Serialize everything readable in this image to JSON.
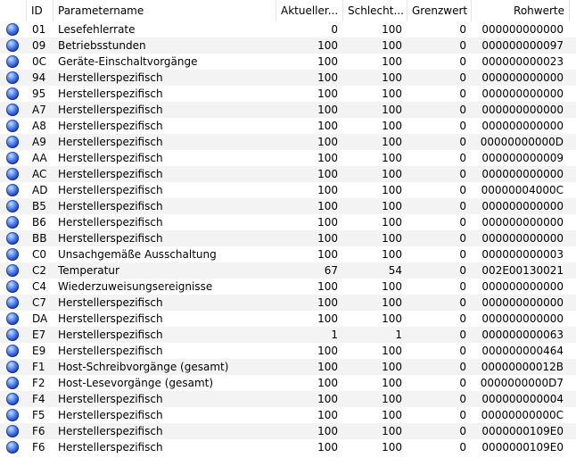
{
  "header": {
    "id": "ID",
    "name": "Parametername",
    "current": "Aktueller...",
    "worst": "Schlecht...",
    "threshold": "Grenzwert",
    "raw": "Rohwerte"
  },
  "icon": "status-dot-blue-icon",
  "rows": [
    {
      "id": "01",
      "name": "Lesefehlerrate",
      "current": "0",
      "worst": "100",
      "threshold": "0",
      "raw": "000000000000"
    },
    {
      "id": "09",
      "name": "Betriebsstunden",
      "current": "100",
      "worst": "100",
      "threshold": "0",
      "raw": "000000000097"
    },
    {
      "id": "0C",
      "name": "Geräte-Einschaltvorgänge",
      "current": "100",
      "worst": "100",
      "threshold": "0",
      "raw": "000000000023"
    },
    {
      "id": "94",
      "name": "Herstellerspezifisch",
      "current": "100",
      "worst": "100",
      "threshold": "0",
      "raw": "000000000000"
    },
    {
      "id": "95",
      "name": "Herstellerspezifisch",
      "current": "100",
      "worst": "100",
      "threshold": "0",
      "raw": "000000000000"
    },
    {
      "id": "A7",
      "name": "Herstellerspezifisch",
      "current": "100",
      "worst": "100",
      "threshold": "0",
      "raw": "000000000000"
    },
    {
      "id": "A8",
      "name": "Herstellerspezifisch",
      "current": "100",
      "worst": "100",
      "threshold": "0",
      "raw": "000000000000"
    },
    {
      "id": "A9",
      "name": "Herstellerspezifisch",
      "current": "100",
      "worst": "100",
      "threshold": "0",
      "raw": "00000000000D"
    },
    {
      "id": "AA",
      "name": "Herstellerspezifisch",
      "current": "100",
      "worst": "100",
      "threshold": "0",
      "raw": "000000000009"
    },
    {
      "id": "AC",
      "name": "Herstellerspezifisch",
      "current": "100",
      "worst": "100",
      "threshold": "0",
      "raw": "000000000000"
    },
    {
      "id": "AD",
      "name": "Herstellerspezifisch",
      "current": "100",
      "worst": "100",
      "threshold": "0",
      "raw": "00000004000C"
    },
    {
      "id": "B5",
      "name": "Herstellerspezifisch",
      "current": "100",
      "worst": "100",
      "threshold": "0",
      "raw": "000000000000"
    },
    {
      "id": "B6",
      "name": "Herstellerspezifisch",
      "current": "100",
      "worst": "100",
      "threshold": "0",
      "raw": "000000000000"
    },
    {
      "id": "BB",
      "name": "Herstellerspezifisch",
      "current": "100",
      "worst": "100",
      "threshold": "0",
      "raw": "000000000000"
    },
    {
      "id": "C0",
      "name": "Unsachgemäße Ausschaltung",
      "current": "100",
      "worst": "100",
      "threshold": "0",
      "raw": "000000000003"
    },
    {
      "id": "C2",
      "name": "Temperatur",
      "current": "67",
      "worst": "54",
      "threshold": "0",
      "raw": "002E00130021"
    },
    {
      "id": "C4",
      "name": "Wiederzuweisungsereignisse",
      "current": "100",
      "worst": "100",
      "threshold": "0",
      "raw": "000000000000"
    },
    {
      "id": "C7",
      "name": "Herstellerspezifisch",
      "current": "100",
      "worst": "100",
      "threshold": "0",
      "raw": "000000000000"
    },
    {
      "id": "DA",
      "name": "Herstellerspezifisch",
      "current": "100",
      "worst": "100",
      "threshold": "0",
      "raw": "000000000000"
    },
    {
      "id": "E7",
      "name": "Herstellerspezifisch",
      "current": "1",
      "worst": "1",
      "threshold": "0",
      "raw": "000000000063"
    },
    {
      "id": "E9",
      "name": "Herstellerspezifisch",
      "current": "100",
      "worst": "100",
      "threshold": "0",
      "raw": "000000000464"
    },
    {
      "id": "F1",
      "name": "Host-Schreibvorgänge (gesamt)",
      "current": "100",
      "worst": "100",
      "threshold": "0",
      "raw": "00000000012B"
    },
    {
      "id": "F2",
      "name": "Host-Lesevorgänge (gesamt)",
      "current": "100",
      "worst": "100",
      "threshold": "0",
      "raw": "0000000000D7"
    },
    {
      "id": "F4",
      "name": "Herstellerspezifisch",
      "current": "100",
      "worst": "100",
      "threshold": "0",
      "raw": "000000000004"
    },
    {
      "id": "F5",
      "name": "Herstellerspezifisch",
      "current": "100",
      "worst": "100",
      "threshold": "0",
      "raw": "00000000000C"
    },
    {
      "id": "F6",
      "name": "Herstellerspezifisch",
      "current": "100",
      "worst": "100",
      "threshold": "0",
      "raw": "0000000109E0"
    },
    {
      "id": "F6",
      "name": "Herstellerspezifisch",
      "current": "100",
      "worst": "100",
      "threshold": "0",
      "raw": "0000000109E0"
    }
  ]
}
